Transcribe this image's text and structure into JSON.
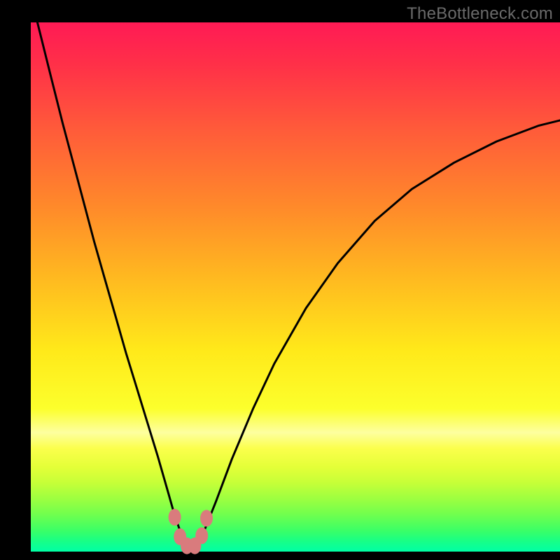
{
  "watermark": "TheBottleneck.com",
  "chart_data": {
    "type": "line",
    "title": "",
    "xlabel": "",
    "ylabel": "",
    "xlim": [
      0,
      100
    ],
    "ylim": [
      0,
      100
    ],
    "series": [
      {
        "name": "bottleneck-curve",
        "x": [
          0,
          2,
          4,
          6,
          8,
          10,
          12,
          14,
          16,
          18,
          20,
          22,
          24,
          26,
          27,
          28,
          29,
          30,
          31,
          32,
          33,
          35,
          38,
          42,
          46,
          52,
          58,
          65,
          72,
          80,
          88,
          96,
          100
        ],
        "values": [
          105,
          97,
          89,
          81,
          73.5,
          66,
          58.5,
          51.5,
          44.5,
          37.5,
          31,
          24.5,
          18,
          11,
          7.5,
          4.5,
          2.3,
          1,
          1,
          2.3,
          4.5,
          9.5,
          17.5,
          27,
          35.5,
          46,
          54.5,
          62.5,
          68.5,
          73.5,
          77.5,
          80.5,
          81.5
        ]
      }
    ],
    "markers": [
      {
        "x": 27.2,
        "y": 6.5
      },
      {
        "x": 28.2,
        "y": 2.8
      },
      {
        "x": 29.5,
        "y": 1.1
      },
      {
        "x": 31.0,
        "y": 1.1
      },
      {
        "x": 32.3,
        "y": 3.0
      },
      {
        "x": 33.2,
        "y": 6.3
      }
    ],
    "colors": {
      "curve": "#000000",
      "marker": "#d97b7d",
      "gradient_top": "#ff1a55",
      "gradient_bottom": "#00ffa5"
    }
  }
}
